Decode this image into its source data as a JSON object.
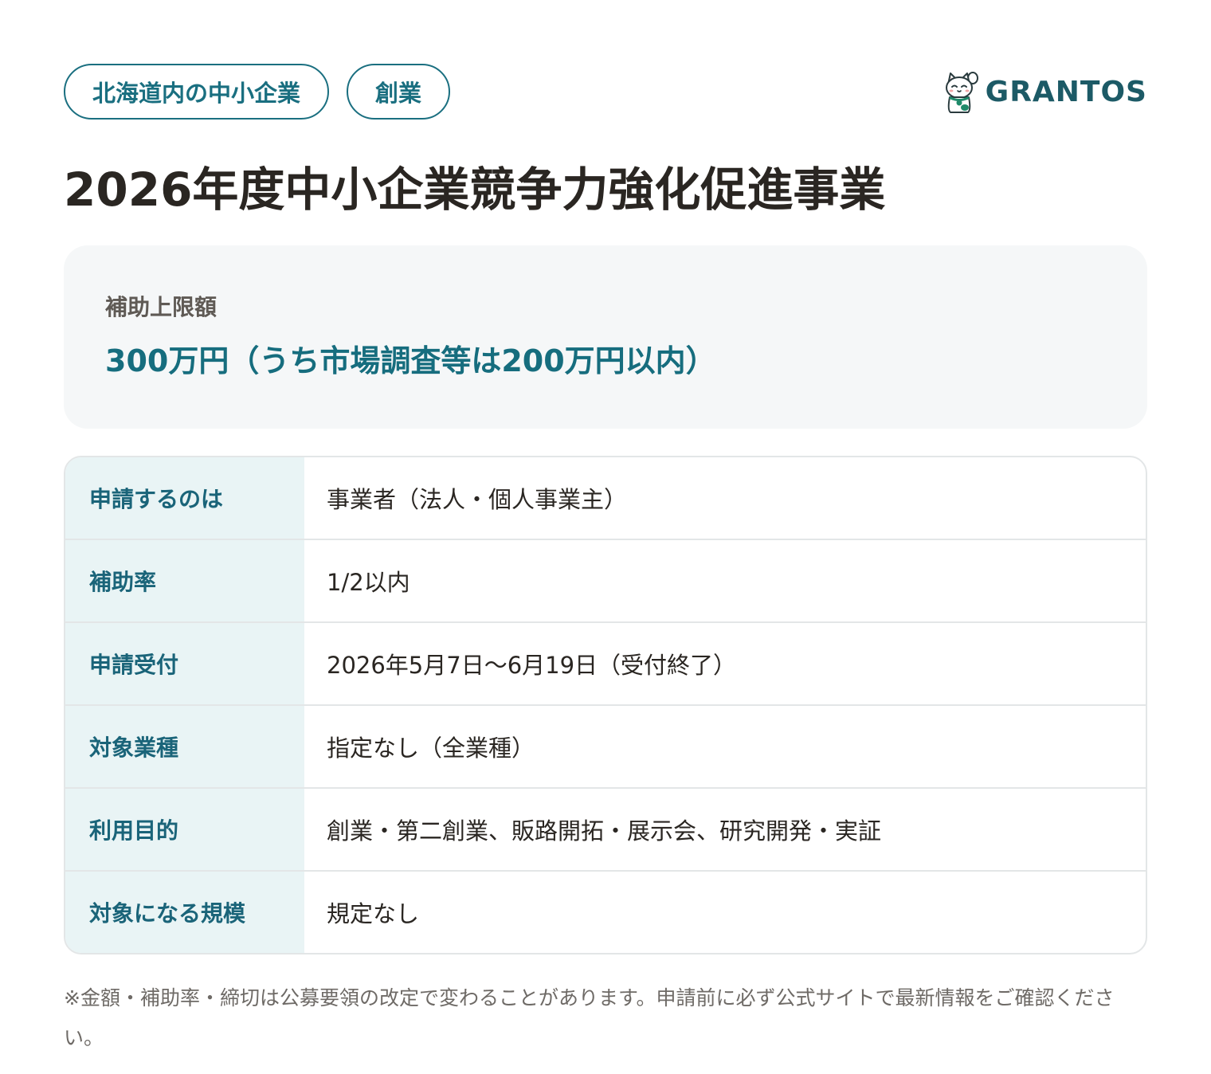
{
  "tags": [
    "北海道内の中小企業",
    "創業"
  ],
  "brand": {
    "name": "GRANTOS",
    "logo_icon": "lucky-cat-icon"
  },
  "title": "2026年度中小企業競争力強化促進事業",
  "amount": {
    "label": "補助上限額",
    "value": "300万円（うち市場調査等は200万円以内）"
  },
  "details": [
    {
      "label": "申請するのは",
      "value": "事業者（法人・個人事業主）"
    },
    {
      "label": "補助率",
      "value": "1/2以内"
    },
    {
      "label": "申請受付",
      "value": "2026年5月7日〜6月19日（受付終了）"
    },
    {
      "label": "対象業種",
      "value": "指定なし（全業種）"
    },
    {
      "label": "利用目的",
      "value": "創業・第二創業、販路開拓・展示会、研究開発・実証"
    },
    {
      "label": "対象になる規模",
      "value": "規定なし"
    }
  ],
  "note": "※金額・補助率・締切は公募要領の改定で変わることがあります。申請前に必ず公式サイトで最新情報をご確認ください。",
  "colors": {
    "accent": "#1a6f80",
    "amount_text": "#166d7e",
    "label_bg": "#e9f4f5",
    "card_bg": "#f5f7f8"
  }
}
